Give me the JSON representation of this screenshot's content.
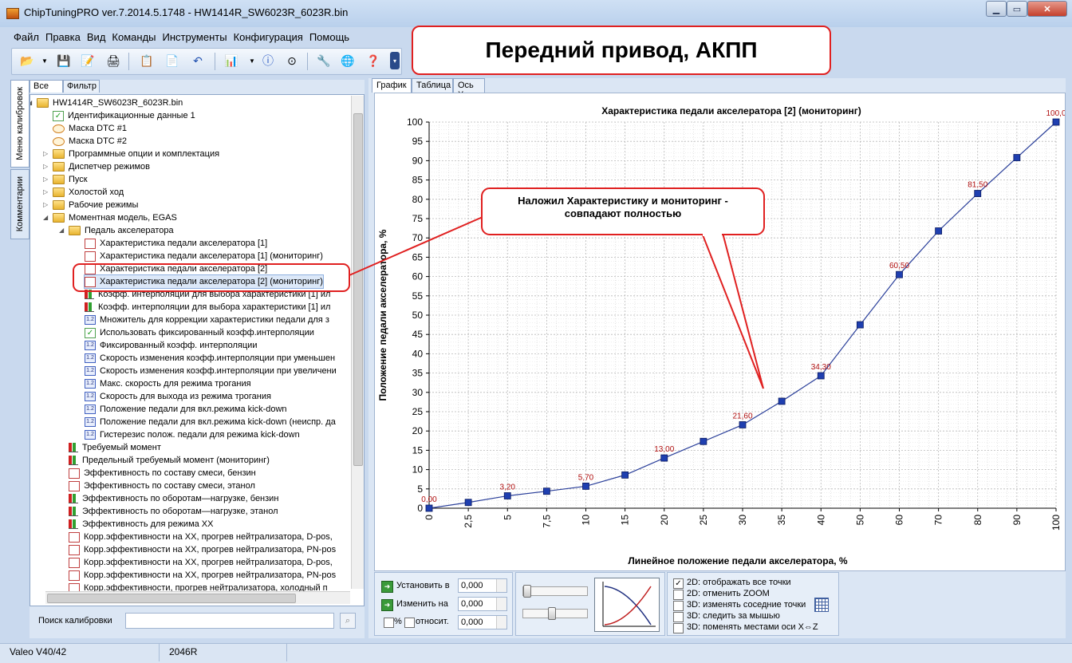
{
  "window": {
    "title": "ChipTuningPRO ver.7.2014.5.1748 - HW1414R_SW6023R_6023R.bin"
  },
  "menu": [
    "Файл",
    "Правка",
    "Вид",
    "Команды",
    "Инструменты",
    "Конфигурация",
    "Помощь"
  ],
  "banner": "Передний привод, АКПП",
  "side_tabs": [
    "Меню калибровок",
    "Комментарии"
  ],
  "left_tabs": [
    "Все",
    "Фильтр"
  ],
  "tree": [
    {
      "level": 0,
      "icon": "folder",
      "text": "HW1414R_SW6023R_6023R.bin",
      "expander": "open"
    },
    {
      "level": 1,
      "icon": "check",
      "text": "Идентификационные данные 1",
      "expander": ""
    },
    {
      "level": 1,
      "icon": "mask",
      "text": "Маска DTC #1",
      "expander": ""
    },
    {
      "level": 1,
      "icon": "mask",
      "text": "Маска DTC #2",
      "expander": ""
    },
    {
      "level": 1,
      "icon": "folder",
      "text": "Программные опции и комплектация",
      "expander": "closed"
    },
    {
      "level": 1,
      "icon": "folder",
      "text": "Диспетчер режимов",
      "expander": "closed"
    },
    {
      "level": 1,
      "icon": "folder",
      "text": "Пуск",
      "expander": "closed"
    },
    {
      "level": 1,
      "icon": "folder",
      "text": "Холостой ход",
      "expander": "closed"
    },
    {
      "level": 1,
      "icon": "folder",
      "text": "Рабочие режимы",
      "expander": "closed"
    },
    {
      "level": 1,
      "icon": "folder",
      "text": "Моментная модель, EGAS",
      "expander": "open"
    },
    {
      "level": 2,
      "icon": "folder",
      "text": "Педаль акселератора",
      "expander": "open"
    },
    {
      "level": 3,
      "icon": "graph",
      "text": "Характеристика педали акселератора [1]",
      "expander": ""
    },
    {
      "level": 3,
      "icon": "graph",
      "text": "Характеристика педали акселератора [1] (мониторинг)",
      "expander": ""
    },
    {
      "level": 3,
      "icon": "graph",
      "text": "Характеристика педали акселератора [2]",
      "expander": ""
    },
    {
      "level": 3,
      "icon": "graph",
      "text": "Характеристика педали акселератора [2] (мониторинг)",
      "expander": "",
      "selected": true
    },
    {
      "level": 3,
      "icon": "bars",
      "text": "Коэфф. интерполяции для выбора характеристики [1] ил",
      "expander": ""
    },
    {
      "level": 3,
      "icon": "bars",
      "text": "Коэфф. интерполяции для выбора характеристики [1] ил",
      "expander": ""
    },
    {
      "level": 3,
      "icon": "num",
      "text": "Множитель для коррекции характеристики педали для з",
      "expander": ""
    },
    {
      "level": 3,
      "icon": "check",
      "text": "Использовать фиксированный коэфф.интерполяции",
      "expander": ""
    },
    {
      "level": 3,
      "icon": "num",
      "text": "Фиксированный коэфф. интерполяции",
      "expander": ""
    },
    {
      "level": 3,
      "icon": "num",
      "text": "Скорость изменения коэфф.интерполяции при уменьшен",
      "expander": ""
    },
    {
      "level": 3,
      "icon": "num",
      "text": "Скорость изменения коэфф.интерполяции при увеличени",
      "expander": ""
    },
    {
      "level": 3,
      "icon": "num",
      "text": "Макс. скорость для режима трогания",
      "expander": ""
    },
    {
      "level": 3,
      "icon": "num",
      "text": "Скорость для выхода из режима трогания",
      "expander": ""
    },
    {
      "level": 3,
      "icon": "num",
      "text": "Положение педали для вкл.режима kick-down",
      "expander": ""
    },
    {
      "level": 3,
      "icon": "num",
      "text": "Положение педали для вкл.режима kick-down (неиспр. да",
      "expander": ""
    },
    {
      "level": 3,
      "icon": "num",
      "text": "Гистерезис полож. педали для режима kick-down",
      "expander": ""
    },
    {
      "level": 2,
      "icon": "bars",
      "text": "Требуемый момент",
      "expander": ""
    },
    {
      "level": 2,
      "icon": "bars",
      "text": "Предельный требуемый момент (мониторинг)",
      "expander": ""
    },
    {
      "level": 2,
      "icon": "graph",
      "text": "Эффективность по составу смеси, бензин",
      "expander": ""
    },
    {
      "level": 2,
      "icon": "graph",
      "text": "Эффективность по составу смеси, этанол",
      "expander": ""
    },
    {
      "level": 2,
      "icon": "bars",
      "text": "Эффективность по оборотам—нагрузке, бензин",
      "expander": ""
    },
    {
      "level": 2,
      "icon": "bars",
      "text": "Эффективность по оборотам—нагрузке, этанол",
      "expander": ""
    },
    {
      "level": 2,
      "icon": "bars",
      "text": "Эффективность для режима XX",
      "expander": ""
    },
    {
      "level": 2,
      "icon": "graph",
      "text": "Корр.эффективности на XX, прогрев нейтрализатора, D-pos,",
      "expander": ""
    },
    {
      "level": 2,
      "icon": "graph",
      "text": "Корр.эффективности на XX, прогрев нейтрализатора, PN-pos",
      "expander": ""
    },
    {
      "level": 2,
      "icon": "graph",
      "text": "Корр.эффективности на XX, прогрев нейтрализатора, D-pos,",
      "expander": ""
    },
    {
      "level": 2,
      "icon": "graph",
      "text": "Корр.эффективности на XX, прогрев нейтрализатора, PN-pos",
      "expander": ""
    },
    {
      "level": 2,
      "icon": "graph",
      "text": "Корр.эффективности, прогрев нейтрализатора, холодный п",
      "expander": ""
    }
  ],
  "search": {
    "label": "Поиск калибровки",
    "value": ""
  },
  "right_tabs": [
    "График",
    "Таблица",
    "Ось X"
  ],
  "callout": "Наложил Характеристику и мониторинг - совпадают полностью",
  "chart_data": {
    "type": "line",
    "title": "Характеристика педали акселератора [2] (мониторинг)",
    "xlabel": "Линейное положение педали акселератора, %",
    "ylabel": "Положение педали акселератора, %",
    "x": [
      0,
      2.5,
      5,
      7.5,
      10,
      15,
      20,
      25,
      30,
      35,
      40,
      50,
      60,
      70,
      80,
      90,
      100
    ],
    "series": [
      {
        "values": [
          0,
          1.5,
          3.2,
          4.4,
          5.7,
          8.6,
          13.0,
          17.3,
          21.6,
          27.7,
          34.3,
          47.5,
          60.5,
          71.8,
          81.5,
          90.8,
          100
        ]
      }
    ],
    "point_labels": [
      "0,00",
      "",
      "3,20",
      "",
      "5,70",
      "",
      "13,00",
      "",
      "21,60",
      "",
      "34,30",
      "",
      "60,50",
      "",
      "81,50",
      "",
      "100,0"
    ],
    "x_ticks": [
      "0",
      "2,5",
      "5",
      "7,5",
      "10",
      "15",
      "20",
      "25",
      "30",
      "35",
      "40",
      "50",
      "60",
      "70",
      "80",
      "90",
      "100"
    ],
    "y_ticks": [
      "0",
      "5",
      "10",
      "15",
      "20",
      "25",
      "30",
      "35",
      "40",
      "45",
      "50",
      "55",
      "60",
      "65",
      "70",
      "75",
      "80",
      "85",
      "90",
      "95",
      "100"
    ],
    "ylim": [
      0,
      100
    ],
    "grid": true,
    "line_color": "#2a3f9a",
    "label_color": "#b01010"
  },
  "controls": {
    "set_label": "Установить в",
    "change_label": "Изменить на",
    "set_value": "0,000",
    "change_value": "0,000",
    "relative_value": "0,000",
    "percent_label": "%",
    "relative_label": "относит.",
    "options": [
      {
        "label": "2D: отображать все точки",
        "checked": true
      },
      {
        "label": "2D: отменить ZOOM",
        "checked": false
      },
      {
        "label": "3D: изменять соседние точки",
        "checked": false
      },
      {
        "label": "3D: следить за мышью",
        "checked": false
      },
      {
        "label": "3D: поменять местами оси X⇔Z",
        "checked": false
      }
    ]
  },
  "status": [
    "Valeo V40/42",
    "2046R"
  ]
}
